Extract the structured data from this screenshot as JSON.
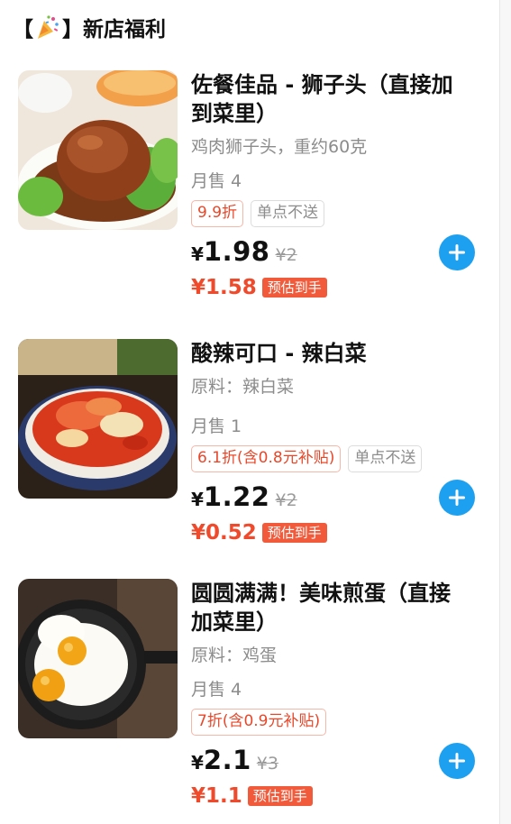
{
  "header": {
    "bracket_open": "【",
    "bracket_close": "】",
    "icon": "party-popper-icon",
    "title": "新店福利"
  },
  "items": [
    {
      "image": "meatball-dish-photo",
      "title_line1": "佐餐佳品 - 狮子头（直接加",
      "title_line2": "到菜里）",
      "desc": "鸡肉狮子头，重约60克",
      "sales": "月售 4",
      "tags": [
        "9.9折",
        "单点不送"
      ],
      "yen": "¥",
      "price": "1.98",
      "orig_price": "¥2",
      "final_price": "¥1.58",
      "est_label": "预估到手"
    },
    {
      "image": "kimchi-bowl-photo",
      "title_line1": "酸辣可口 - 辣白菜",
      "title_line2": "",
      "desc": "原料：辣白菜",
      "sales": "月售 1",
      "tags": [
        "6.1折(含0.8元补贴)",
        "单点不送"
      ],
      "yen": "¥",
      "price": "1.22",
      "orig_price": "¥2",
      "final_price": "¥0.52",
      "est_label": "预估到手"
    },
    {
      "image": "fried-egg-pan-photo",
      "title_line1": "圆圆满满！美味煎蛋（直接",
      "title_line2": "加菜里）",
      "desc": "原料：鸡蛋",
      "sales": "月售 4",
      "tags": [
        "7折(含0.9元补贴)"
      ],
      "yen": "¥",
      "price": "2.1",
      "orig_price": "¥3",
      "final_price": "¥1.1",
      "est_label": "预估到手"
    }
  ],
  "colors": {
    "accent_red": "#ef4a2b",
    "badge_bg": "#f15a3a",
    "add_button": "#1ea0f0",
    "muted_text": "#8c8c8c"
  }
}
